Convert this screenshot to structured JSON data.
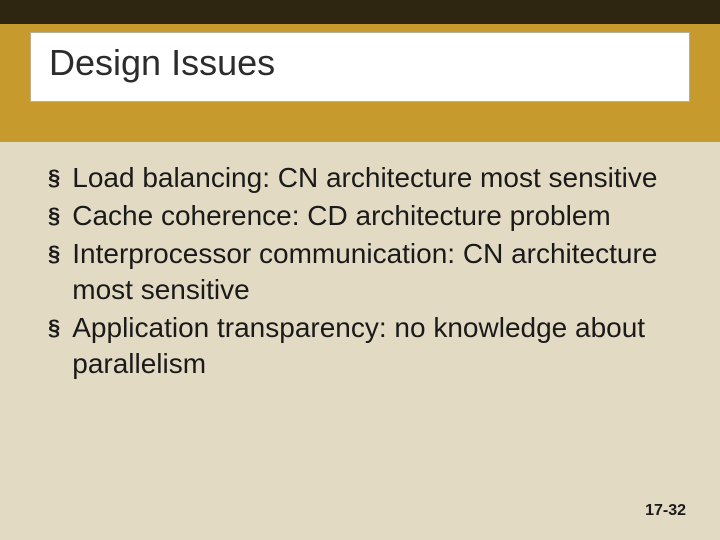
{
  "slide": {
    "title": "Design Issues",
    "bullets": [
      "Load balancing: CN architecture most sensitive",
      "Cache coherence: CD architecture problem",
      "Interprocessor communication: CN architecture most sensitive",
      "Application transparency: no knowledge about parallelism"
    ],
    "bullet_glyph": "§",
    "page_number": "17-32"
  }
}
